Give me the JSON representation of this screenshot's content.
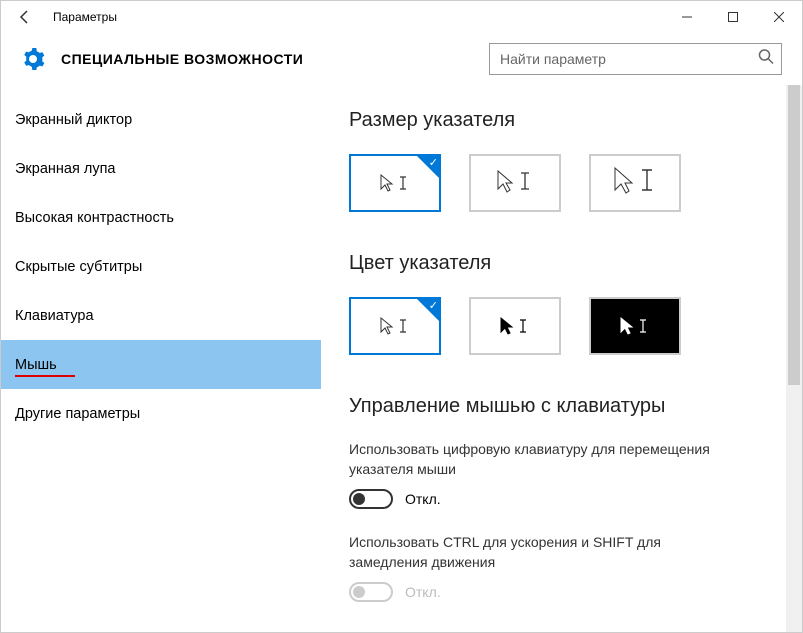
{
  "titlebar": {
    "title": "Параметры"
  },
  "header": {
    "section_title": "СПЕЦИАЛЬНЫЕ ВОЗМОЖНОСТИ",
    "search_placeholder": "Найти параметр"
  },
  "sidebar": {
    "items": [
      {
        "label": "Экранный диктор"
      },
      {
        "label": "Экранная лупа"
      },
      {
        "label": "Высокая контрастность"
      },
      {
        "label": "Скрытые субтитры"
      },
      {
        "label": "Клавиатура"
      },
      {
        "label": "Мышь"
      },
      {
        "label": "Другие параметры"
      }
    ]
  },
  "main": {
    "pointer_size_heading": "Размер указателя",
    "pointer_color_heading": "Цвет указателя",
    "keyboard_mouse_heading": "Управление мышью с клавиатуры",
    "toggle1_label": "Использовать цифровую клавиатуру для перемещения указателя мыши",
    "toggle1_state": "Откл.",
    "toggle2_label": "Использовать CTRL для ускорения и SHIFT для замедления движения",
    "toggle2_state": "Откл."
  }
}
